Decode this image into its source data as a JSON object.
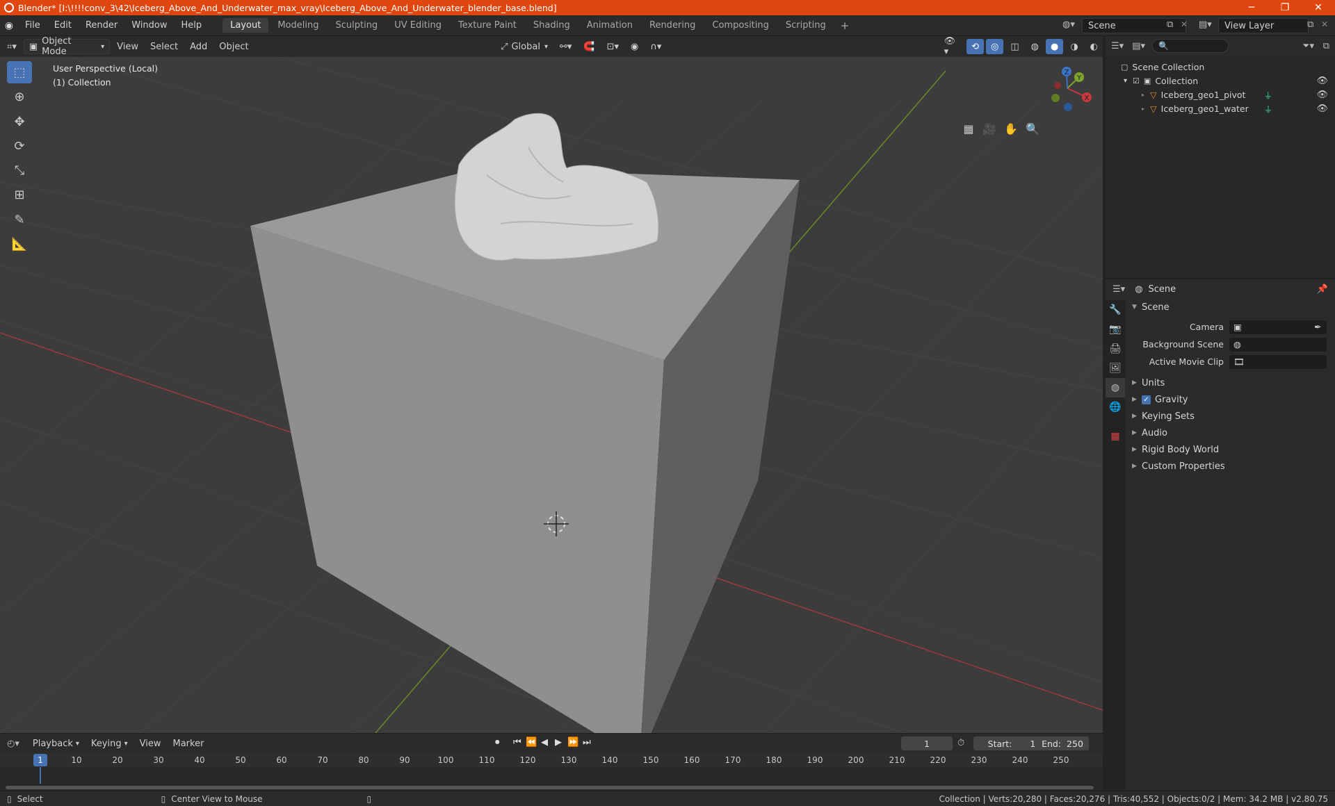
{
  "window": {
    "title": "Blender* [I:\\!!!!conv_3\\42\\Iceberg_Above_And_Underwater_max_vray\\Iceberg_Above_And_Underwater_blender_base.blend]",
    "minimize": "─",
    "maximize": "❐",
    "close": "✕"
  },
  "menu": [
    "File",
    "Edit",
    "Render",
    "Window",
    "Help"
  ],
  "workspaces": [
    "Layout",
    "Modeling",
    "Sculpting",
    "UV Editing",
    "Texture Paint",
    "Shading",
    "Animation",
    "Rendering",
    "Compositing",
    "Scripting"
  ],
  "workspace_add": "+",
  "scene": {
    "name": "Scene",
    "view_layer": "View Layer"
  },
  "viewport_header": {
    "mode": "Object Mode",
    "view": "View",
    "select": "Select",
    "add": "Add",
    "object": "Object",
    "orientation": "Global"
  },
  "viewport": {
    "perspective": "User Perspective (Local)",
    "collection": "(1) Collection"
  },
  "gizmo": {
    "x": "X",
    "y": "Y",
    "z": "Z"
  },
  "outliner": {
    "root": "Scene Collection",
    "collection": "Collection",
    "objects": [
      "Iceberg_geo1_pivot",
      "Iceberg_geo1_water"
    ]
  },
  "properties": {
    "header": "Scene",
    "section": "Scene",
    "camera_label": "Camera",
    "bg_scene_label": "Background Scene",
    "movie_clip_label": "Active Movie Clip",
    "subsections": [
      "Units",
      "Gravity",
      "Keying Sets",
      "Audio",
      "Rigid Body World",
      "Custom Properties"
    ]
  },
  "timeline": {
    "playback": "Playback",
    "keying": "Keying",
    "view": "View",
    "marker": "Marker",
    "current_frame": "1",
    "start_label": "Start:",
    "start": "1",
    "end_label": "End:",
    "end": "250",
    "ticks": [
      "1",
      "10",
      "20",
      "30",
      "40",
      "50",
      "60",
      "70",
      "80",
      "90",
      "100",
      "110",
      "120",
      "130",
      "140",
      "150",
      "160",
      "170",
      "180",
      "190",
      "200",
      "210",
      "220",
      "230",
      "240",
      "250"
    ]
  },
  "status": {
    "select": "Select",
    "center": "Center View to Mouse",
    "stats": "Collection | Verts:20,280 | Faces:20,276 | Tris:40,552 | Objects:0/2 | Mem: 34.2 MB | v2.80.75"
  },
  "colors": {
    "title_bar": "#e0460f",
    "accent": "#4772b3",
    "x_axis": "#c8383e",
    "y_axis": "#7fa32c",
    "z_axis": "#3c74c9"
  }
}
